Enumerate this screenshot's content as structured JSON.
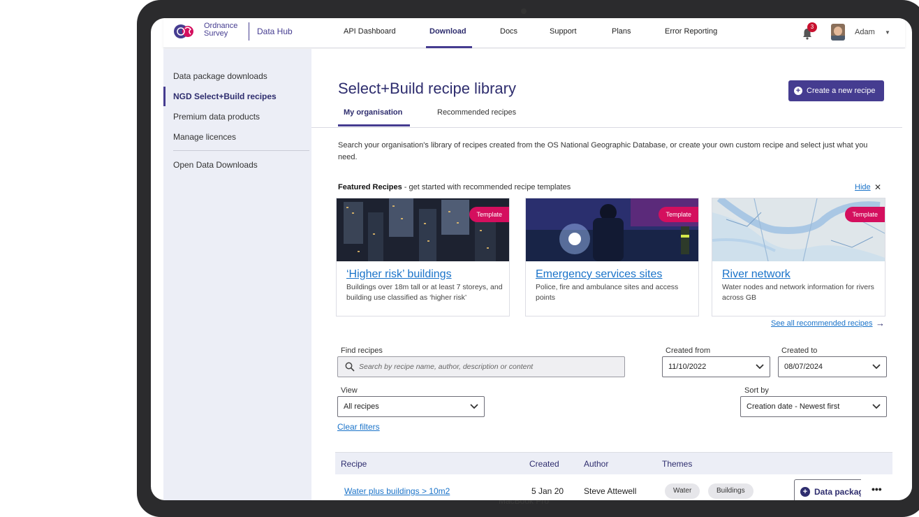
{
  "device": {
    "label": "MacBook Pro"
  },
  "header": {
    "logo_line1": "Ordnance",
    "logo_line2": "Survey",
    "product": "Data Hub",
    "nav": [
      "API Dashboard",
      "Download",
      "Docs",
      "Support",
      "Plans",
      "Error Reporting"
    ],
    "active_nav": "Download",
    "notification_count": "3",
    "user_name": "Adam"
  },
  "sidebar": {
    "items": [
      "Data package downloads",
      "NGD Select+Build recipes",
      "Premium data products",
      "Manage licences"
    ],
    "active": "NGD Select+Build recipes",
    "secondary": [
      "Open Data Downloads"
    ]
  },
  "main": {
    "title": "Select+Build recipe library",
    "create_button": "Create a new recipe",
    "tabs": [
      "My organisation",
      "Recommended recipes"
    ],
    "intro": "Search your organisation's library of recipes created from the OS National Geographic Database, or create your own custom recipe and select just what you need.",
    "featured_bold": "Featured Recipes",
    "featured_rest": " - get started with recommended recipe templates",
    "hide": "Hide",
    "cards": [
      {
        "tag": "Template",
        "title": "‘Higher risk’ buildings",
        "desc": "Buildings over 18m tall or at least 7 storeys, and building use classified as ‘higher risk’"
      },
      {
        "tag": "Template",
        "title": "Emergency services sites",
        "desc": "Police, fire and ambulance sites and access points"
      },
      {
        "tag": "Template",
        "title": "River network",
        "desc": "Water nodes and network information for rivers across GB"
      }
    ],
    "see_all": "See all recommended recipes",
    "filters": {
      "find_label": "Find recipes",
      "find_placeholder": "Search by recipe name, author, description or content",
      "created_from_label": "Created from",
      "created_from": "11/10/2022",
      "created_to_label": "Created to",
      "created_to": "08/07/2024",
      "view_label": "View",
      "view": "All recipes",
      "sort_label": "Sort by",
      "sort": "Creation date - Newest first",
      "clear": "Clear filters"
    },
    "table": {
      "headers": [
        "Recipe",
        "Created",
        "Author",
        "Themes"
      ],
      "rows": [
        {
          "recipe": "Water plus buildings > 10m2",
          "created": "5 Jan 20",
          "author": "Steve Attewell",
          "themes": [
            "Water",
            "Buildings"
          ],
          "action": "Data package"
        }
      ]
    }
  }
}
